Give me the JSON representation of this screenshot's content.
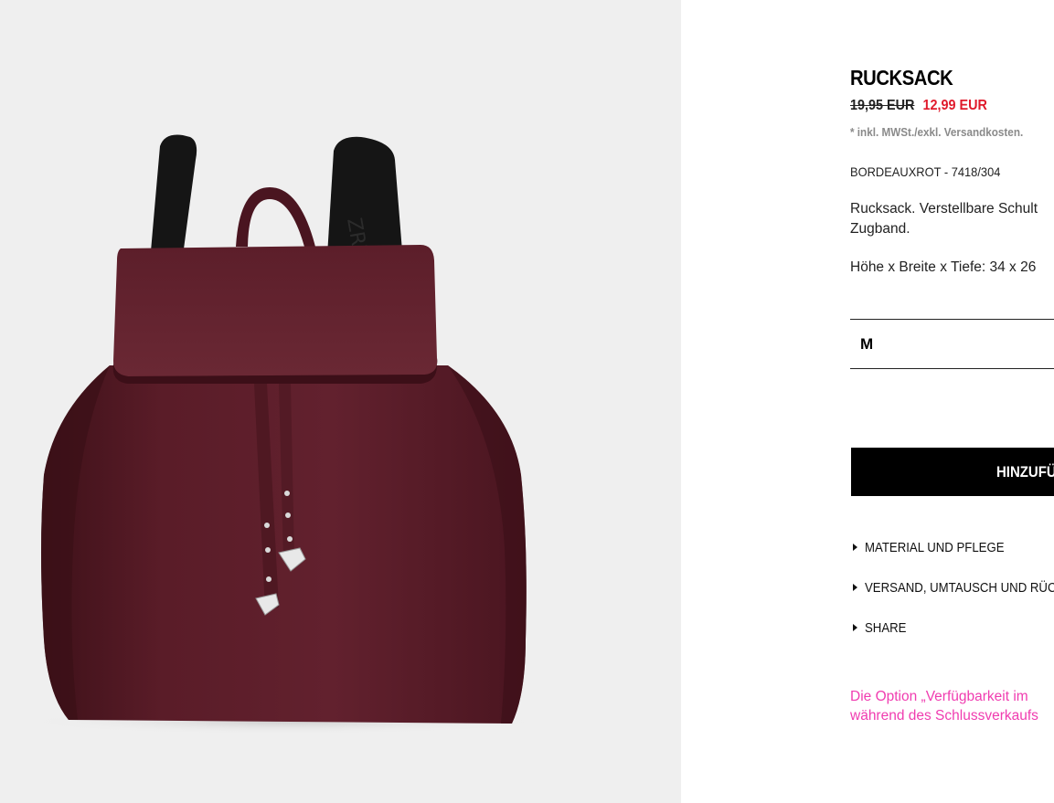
{
  "product": {
    "title": "RUCKSACK",
    "price_old": "19,95 EUR",
    "price_new": "12,99 EUR",
    "tax_note": "* inkl. MWSt./exkl. Versandkosten.",
    "color_reference": "BORDEAUXROT - 7418/304",
    "description_lines": [
      "Rucksack. Verstellbare Schult",
      "Zugband."
    ],
    "dimensions": "Höhe x Breite x Tiefe: 34 x 26",
    "size_selected": "M",
    "add_button_label": "HINZUFÜ",
    "image_alt": "Bordeauxroter Rucksack"
  },
  "accordion": [
    {
      "label": "MATERIAL UND PFLEGE"
    },
    {
      "label": "VERSAND, UMTAUSCH UND RÜC"
    },
    {
      "label": "SHARE"
    }
  ],
  "notice_lines": [
    "Die Option „Verfügbarkeit im",
    "während des Schlussverkaufs"
  ],
  "colors": {
    "price_sale": "#e01a2b",
    "notice": "#f03cb0",
    "image_bg": "#efefef",
    "bag": "#5b1f2b"
  }
}
